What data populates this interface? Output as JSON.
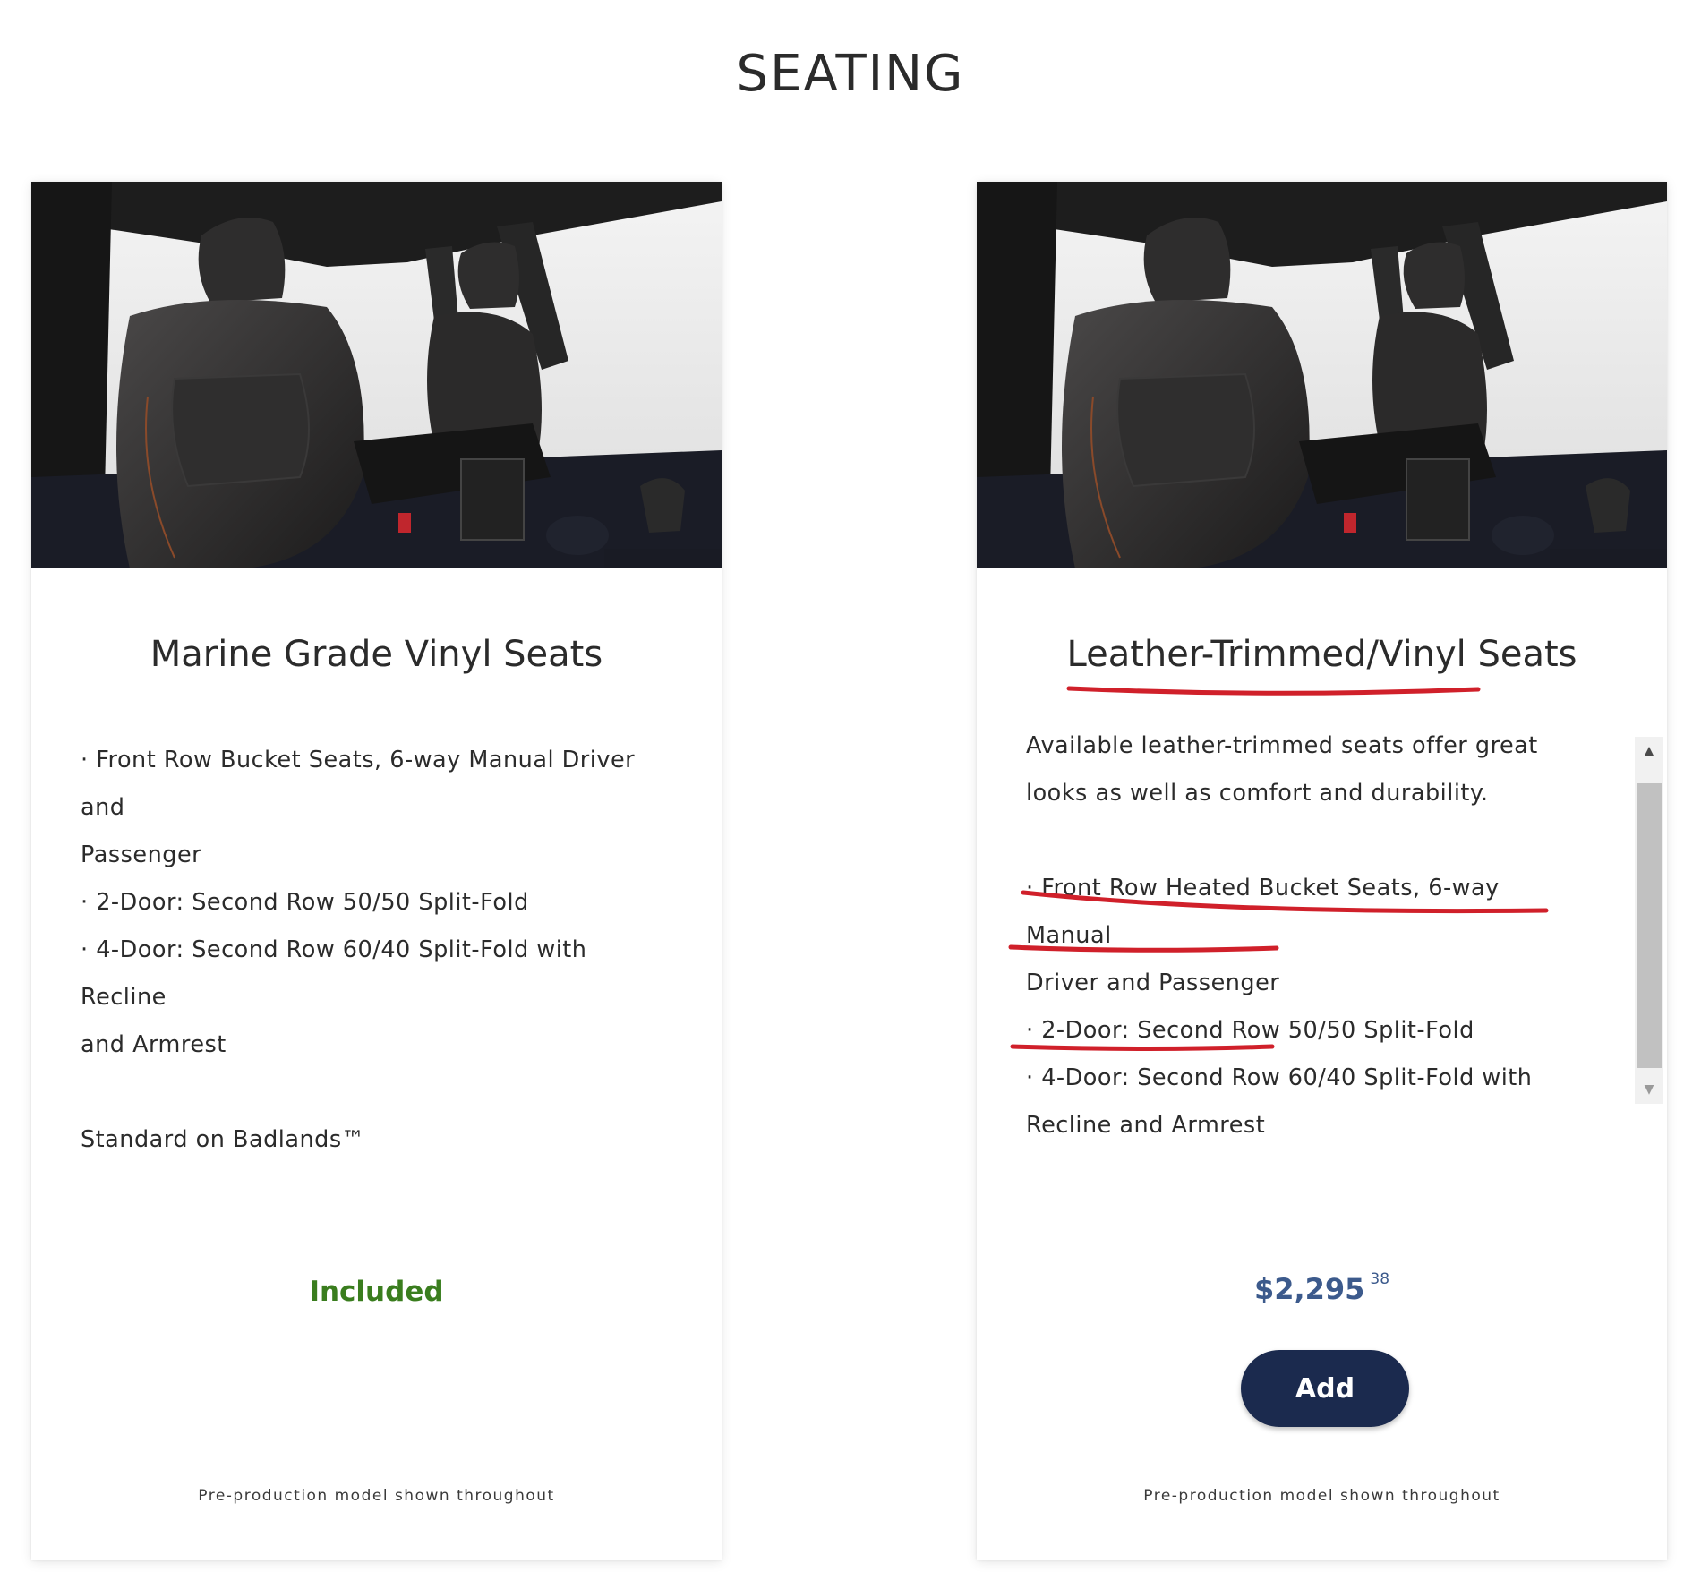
{
  "page": {
    "title": "SEATING"
  },
  "cards": [
    {
      "title": "Marine Grade Vinyl Seats",
      "description_lines": [],
      "features": [
        "· Front Row Bucket Seats, 6-way Manual Driver and",
        "Passenger",
        "· 2-Door: Second Row 50/50 Split-Fold",
        "· 4-Door: Second Row 60/40 Split-Fold with Recline",
        "and Armrest"
      ],
      "note": "Standard on Badlands™",
      "status": "Included",
      "footnote": "Pre-production model shown throughout"
    },
    {
      "title": "Leather-Trimmed/Vinyl Seats",
      "description_lines": [
        "Available leather-trimmed seats offer great",
        "looks as well as comfort and durability."
      ],
      "features": [
        "· Front Row Heated Bucket Seats, 6-way Manual",
        "Driver and Passenger",
        "· 2-Door: Second Row 50/50 Split-Fold",
        "· 4-Door: Second Row 60/40 Split-Fold with",
        "Recline and Armrest"
      ],
      "price": {
        "dollars": "$2,295",
        "cents": "38"
      },
      "add_label": "Add",
      "footnote": "Pre-production model shown throughout"
    }
  ],
  "icons": {
    "scroll_up": "triangle-up-icon",
    "scroll_down": "triangle-down-icon"
  },
  "colors": {
    "included_green": "#3a7d1e",
    "price_blue": "#3c5a8c",
    "button_navy": "#1b2a4e",
    "annotation_red": "#d0202a"
  }
}
